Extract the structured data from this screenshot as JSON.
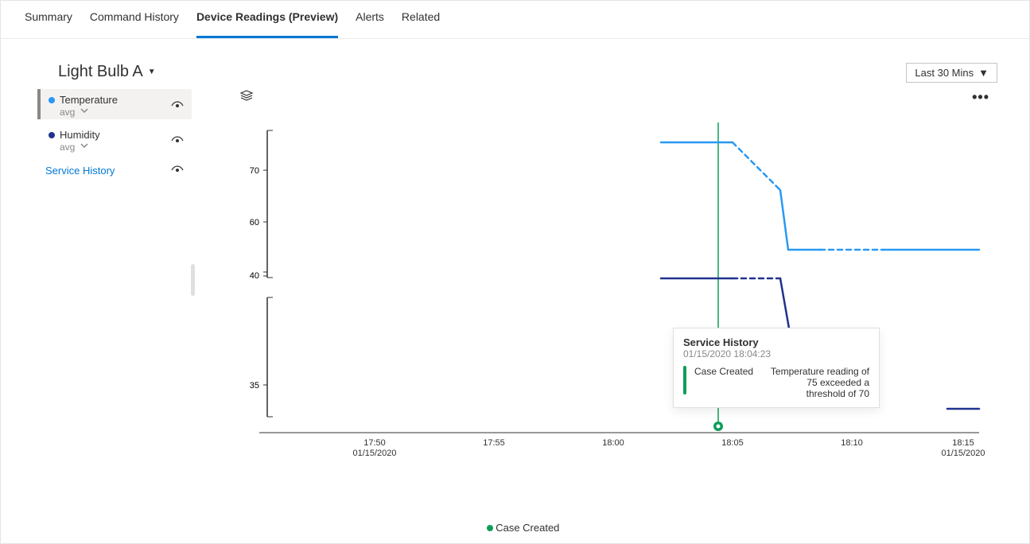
{
  "tabs": [
    {
      "label": "Summary",
      "active": false
    },
    {
      "label": "Command History",
      "active": false
    },
    {
      "label": "Device Readings (Preview)",
      "active": true
    },
    {
      "label": "Alerts",
      "active": false
    },
    {
      "label": "Related",
      "active": false
    }
  ],
  "device": {
    "name": "Light Bulb A"
  },
  "time_range": {
    "label": "Last 30 Mins"
  },
  "legend": {
    "items": [
      {
        "name": "Temperature",
        "agg": "avg",
        "color": "#2899f5",
        "selected": true
      },
      {
        "name": "Humidity",
        "agg": "avg",
        "color": "#20328f",
        "selected": false
      }
    ],
    "service_history_label": "Service History"
  },
  "tooltip": {
    "title": "Service History",
    "timestamp": "01/15/2020 18:04:23",
    "event": "Case Created",
    "description": "Temperature reading of 75 exceeded a threshold of 70"
  },
  "bottom_legend": {
    "label": "Case Created",
    "color": "#0f9d58"
  },
  "chart_data": {
    "type": "line",
    "x_ticks": [
      "17:50",
      "17:55",
      "18:00",
      "18:05",
      "18:10",
      "18:15"
    ],
    "x_date_start": "01/15/2020",
    "x_date_end": "01/15/2020",
    "y_axes": [
      {
        "series": "Temperature",
        "ticks": [
          40,
          60,
          70
        ],
        "range": [
          40,
          78
        ]
      },
      {
        "series": "Humidity",
        "ticks": [
          35
        ],
        "range": [
          32,
          42
        ]
      }
    ],
    "event_marker": {
      "x": "18:04.4",
      "label": "Case Created"
    },
    "series": [
      {
        "name": "Temperature",
        "color": "#2899f5",
        "segments": [
          {
            "points": [
              [
                "18:03",
                75
              ],
              [
                "18:05",
                75
              ]
            ],
            "dashed": false
          },
          {
            "points": [
              [
                "18:05",
                75
              ],
              [
                "18:07",
                66
              ]
            ],
            "dashed": true
          },
          {
            "points": [
              [
                "18:07",
                66
              ],
              [
                "18:07.3",
                55
              ],
              [
                "18:08.5",
                55
              ]
            ],
            "dashed": false
          },
          {
            "points": [
              [
                "18:08.5",
                55
              ],
              [
                "18:11",
                55
              ]
            ],
            "dashed": true
          },
          {
            "points": [
              [
                "18:11",
                55
              ],
              [
                "18:15",
                55
              ]
            ],
            "dashed": false
          }
        ]
      },
      {
        "name": "Humidity",
        "color": "#20328f",
        "segments": [
          {
            "points": [
              [
                "18:03",
                40
              ],
              [
                "18:05",
                40
              ]
            ],
            "dashed": false
          },
          {
            "points": [
              [
                "18:05",
                40
              ],
              [
                "18:07",
                40
              ]
            ],
            "dashed": true
          },
          {
            "points": [
              [
                "18:07",
                40
              ],
              [
                "18:07.5",
                33
              ]
            ],
            "dashed": false
          },
          {
            "points": [
              [
                "18:14.2",
                33
              ],
              [
                "18:15",
                33
              ]
            ],
            "dashed": false
          }
        ]
      }
    ]
  }
}
